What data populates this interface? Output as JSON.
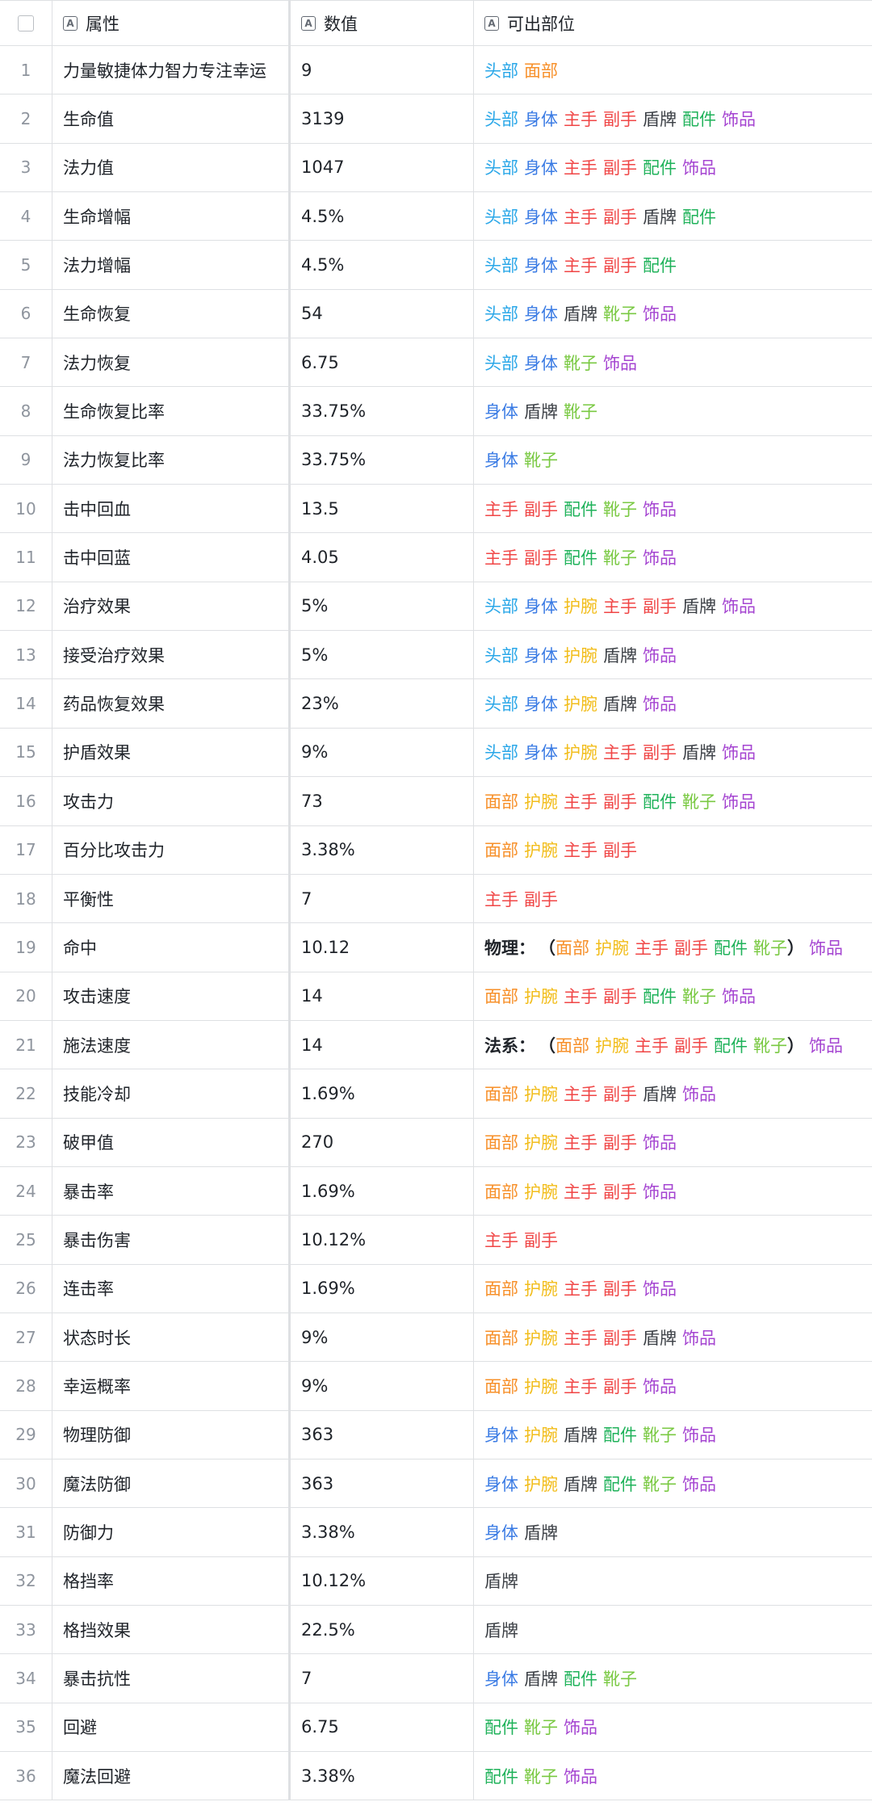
{
  "header": {
    "attr_label": "属性",
    "value_label": "数值",
    "parts_label": "可出部位"
  },
  "colors": {
    "头部": "#2aa7e8",
    "面部": "#f7902a",
    "身体": "#3a7be4",
    "主手": "#f04646",
    "副手": "#f04646",
    "盾牌": "#3b3f45",
    "配件": "#1fb25a",
    "饰品": "#a545d1",
    "护腕": "#f2bd1b",
    "靴子": "#7ac943",
    "paren": "#1f2329"
  },
  "rows": [
    {
      "idx": "1",
      "attr": "力量敏捷体力智力专注幸运",
      "value": "9",
      "parts": [
        "头部",
        "面部"
      ]
    },
    {
      "idx": "2",
      "attr": "生命值",
      "value": "3139",
      "parts": [
        "头部",
        "身体",
        "主手",
        "副手",
        "盾牌",
        "配件",
        "饰品"
      ]
    },
    {
      "idx": "3",
      "attr": "法力值",
      "value": "1047",
      "parts": [
        "头部",
        "身体",
        "主手",
        "副手",
        "配件",
        "饰品"
      ]
    },
    {
      "idx": "4",
      "attr": "生命增幅",
      "value": "4.5%",
      "parts": [
        "头部",
        "身体",
        "主手",
        "副手",
        "盾牌",
        "配件"
      ]
    },
    {
      "idx": "5",
      "attr": "法力增幅",
      "value": "4.5%",
      "parts": [
        "头部",
        "身体",
        "主手",
        "副手",
        "配件"
      ]
    },
    {
      "idx": "6",
      "attr": "生命恢复",
      "value": "54",
      "parts": [
        "头部",
        "身体",
        "盾牌",
        "靴子",
        "饰品"
      ]
    },
    {
      "idx": "7",
      "attr": "法力恢复",
      "value": "6.75",
      "parts": [
        "头部",
        "身体",
        "靴子",
        "饰品"
      ]
    },
    {
      "idx": "8",
      "attr": "生命恢复比率",
      "value": "33.75%",
      "parts": [
        "身体",
        "盾牌",
        "靴子"
      ]
    },
    {
      "idx": "9",
      "attr": "法力恢复比率",
      "value": "33.75%",
      "parts": [
        "身体",
        "靴子"
      ]
    },
    {
      "idx": "10",
      "attr": "击中回血",
      "value": "13.5",
      "parts": [
        "主手",
        "副手",
        "配件",
        "靴子",
        "饰品"
      ]
    },
    {
      "idx": "11",
      "attr": "击中回蓝",
      "value": "4.05",
      "parts": [
        "主手",
        "副手",
        "配件",
        "靴子",
        "饰品"
      ]
    },
    {
      "idx": "12",
      "attr": "治疗效果",
      "value": "5%",
      "parts": [
        "头部",
        "身体",
        "护腕",
        "主手",
        "副手",
        "盾牌",
        "饰品"
      ]
    },
    {
      "idx": "13",
      "attr": "接受治疗效果",
      "value": "5%",
      "parts": [
        "头部",
        "身体",
        "护腕",
        "盾牌",
        "饰品"
      ]
    },
    {
      "idx": "14",
      "attr": "药品恢复效果",
      "value": "23%",
      "parts": [
        "头部",
        "身体",
        "护腕",
        "盾牌",
        "饰品"
      ]
    },
    {
      "idx": "15",
      "attr": "护盾效果",
      "value": "9%",
      "parts": [
        "头部",
        "身体",
        "护腕",
        "主手",
        "副手",
        "盾牌",
        "饰品"
      ]
    },
    {
      "idx": "16",
      "attr": "攻击力",
      "value": "73",
      "parts": [
        "面部",
        "护腕",
        "主手",
        "副手",
        "配件",
        "靴子",
        "饰品"
      ]
    },
    {
      "idx": "17",
      "attr": "百分比攻击力",
      "value": "3.38%",
      "parts": [
        "面部",
        "护腕",
        "主手",
        "副手"
      ]
    },
    {
      "idx": "18",
      "attr": "平衡性",
      "value": "7",
      "parts": [
        "主手",
        "副手"
      ]
    },
    {
      "idx": "19",
      "attr": "命中",
      "value": "10.12",
      "prefix": "物理：",
      "paren_parts": [
        "面部",
        "护腕",
        "主手",
        "副手",
        "配件",
        "靴子"
      ],
      "parts": [
        "饰品"
      ]
    },
    {
      "idx": "20",
      "attr": "攻击速度",
      "value": "14",
      "parts": [
        "面部",
        "护腕",
        "主手",
        "副手",
        "配件",
        "靴子",
        "饰品"
      ]
    },
    {
      "idx": "21",
      "attr": "施法速度",
      "value": "14",
      "prefix": "法系：",
      "paren_parts": [
        "面部",
        "护腕",
        "主手",
        "副手",
        "配件",
        "靴子"
      ],
      "parts": [
        "饰品"
      ]
    },
    {
      "idx": "22",
      "attr": "技能冷却",
      "value": "1.69%",
      "parts": [
        "面部",
        "护腕",
        "主手",
        "副手",
        "盾牌",
        "饰品"
      ]
    },
    {
      "idx": "23",
      "attr": "破甲值",
      "value": "270",
      "parts": [
        "面部",
        "护腕",
        "主手",
        "副手",
        "饰品"
      ]
    },
    {
      "idx": "24",
      "attr": "暴击率",
      "value": "1.69%",
      "parts": [
        "面部",
        "护腕",
        "主手",
        "副手",
        "饰品"
      ]
    },
    {
      "idx": "25",
      "attr": "暴击伤害",
      "value": "10.12%",
      "parts": [
        "主手",
        "副手"
      ]
    },
    {
      "idx": "26",
      "attr": "连击率",
      "value": "1.69%",
      "parts": [
        "面部",
        "护腕",
        "主手",
        "副手",
        "饰品"
      ]
    },
    {
      "idx": "27",
      "attr": "状态时长",
      "value": "9%",
      "parts": [
        "面部",
        "护腕",
        "主手",
        "副手",
        "盾牌",
        "饰品"
      ]
    },
    {
      "idx": "28",
      "attr": "幸运概率",
      "value": "9%",
      "parts": [
        "面部",
        "护腕",
        "主手",
        "副手",
        "饰品"
      ]
    },
    {
      "idx": "29",
      "attr": "物理防御",
      "value": "363",
      "parts": [
        "身体",
        "护腕",
        "盾牌",
        "配件",
        "靴子",
        "饰品"
      ]
    },
    {
      "idx": "30",
      "attr": "魔法防御",
      "value": "363",
      "parts": [
        "身体",
        "护腕",
        "盾牌",
        "配件",
        "靴子",
        "饰品"
      ]
    },
    {
      "idx": "31",
      "attr": "防御力",
      "value": "3.38%",
      "parts": [
        "身体",
        "盾牌"
      ]
    },
    {
      "idx": "32",
      "attr": "格挡率",
      "value": "10.12%",
      "parts": [
        "盾牌"
      ]
    },
    {
      "idx": "33",
      "attr": "格挡效果",
      "value": "22.5%",
      "parts": [
        "盾牌"
      ]
    },
    {
      "idx": "34",
      "attr": "暴击抗性",
      "value": "7",
      "parts": [
        "身体",
        "盾牌",
        "配件",
        "靴子"
      ]
    },
    {
      "idx": "35",
      "attr": "回避",
      "value": "6.75",
      "parts": [
        "配件",
        "靴子",
        "饰品"
      ]
    },
    {
      "idx": "36",
      "attr": "魔法回避",
      "value": "3.38%",
      "parts": [
        "配件",
        "靴子",
        "饰品"
      ]
    }
  ]
}
